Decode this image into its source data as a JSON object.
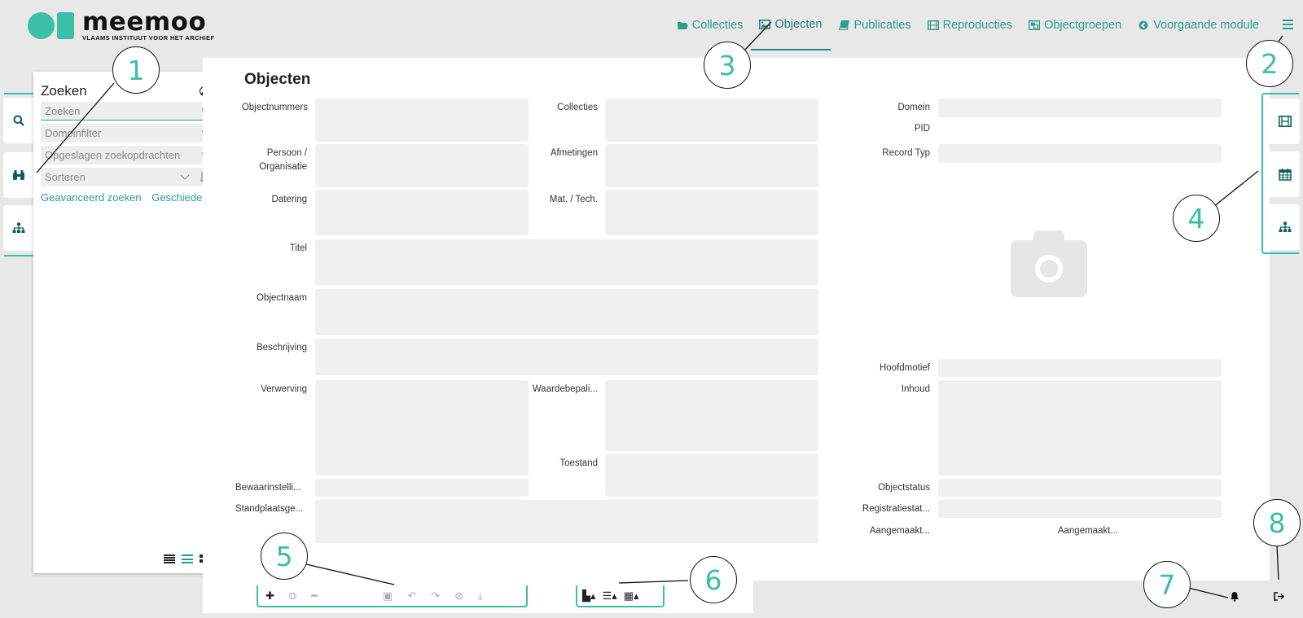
{
  "brand": {
    "name": "meemoo",
    "tagline": "VLAAMS INSTITUUT VOOR HET ARCHIEF"
  },
  "nav": [
    {
      "label": "Collecties",
      "icon": "folder-open-icon"
    },
    {
      "label": "Objecten",
      "icon": "image-icon",
      "active": true
    },
    {
      "label": "Publicaties",
      "icon": "book-icon"
    },
    {
      "label": "Reproducties",
      "icon": "film-icon"
    },
    {
      "label": "Objectgroepen",
      "icon": "object-group-icon"
    },
    {
      "label": "Voorgaande module",
      "icon": "arrow-circle-left-icon"
    }
  ],
  "search": {
    "title": "Zoeken",
    "input_placeholder": "Zoeken",
    "domain_filter": "Domeinfilter",
    "saved_queries": "Opgeslagen zoekopdrachten",
    "sort": "Sorteren",
    "advanced": "Geavanceerd zoeken",
    "history": "Geschiedenis"
  },
  "form": {
    "title": "Objecten",
    "labels": {
      "objectnummers": "Objectnummers",
      "collecties": "Collecties",
      "domein": "Domein",
      "pid": "PID",
      "persoon": "Persoon / Organisatie",
      "afmetingen": "Afmetingen",
      "record_typ": "Record Typ",
      "datering": "Datering",
      "mat_tech": "Mat. / Tech.",
      "titel": "Titel",
      "objectnaam": "Objectnaam",
      "beschrijving": "Beschrijving",
      "hoofdmotief": "Hoofdmotief",
      "verwerving": "Verwerving",
      "waardebepaling": "Waardebepali...",
      "inhoud": "Inhoud",
      "toestand": "Toestand",
      "bewaarinstelling": "Bewaarinstelli...",
      "objectstatus": "Objectstatus",
      "standplaats": "Standplaatsge...",
      "registratiestatus": "Registratiestat...",
      "aangemaakt1": "Aangemaakt...",
      "aangemaakt2": "Aangemaakt..."
    }
  },
  "callouts": [
    "1",
    "2",
    "3",
    "4",
    "5",
    "6",
    "7",
    "8"
  ],
  "accent": "#3bbfa6",
  "link_color": "#2a9d8f"
}
